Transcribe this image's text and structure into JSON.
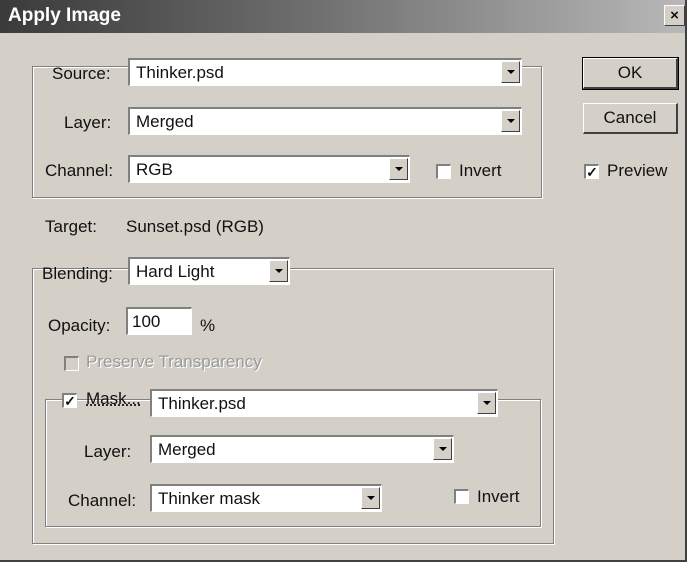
{
  "window": {
    "title": "Apply Image",
    "close_glyph": "×"
  },
  "source": {
    "source_label": "Source:",
    "source_value": "Thinker.psd",
    "layer_label": "Layer:",
    "layer_value": "Merged",
    "channel_label": "Channel:",
    "channel_value": "RGB",
    "invert_label": "Invert",
    "invert_checked": false
  },
  "target": {
    "label": "Target:",
    "value": "Sunset.psd (RGB)"
  },
  "blending": {
    "blending_label": "Blending:",
    "blending_value": "Hard Light",
    "opacity_label": "Opacity:",
    "opacity_value": "100",
    "opacity_unit": "%",
    "preserve_label": "Preserve Transparency",
    "preserve_enabled": false,
    "mask_label": "Mask...",
    "mask_checked": true,
    "mask_value": "Thinker.psd",
    "mask_layer_label": "Layer:",
    "mask_layer_value": "Merged",
    "mask_channel_label": "Channel:",
    "mask_channel_value": "Thinker mask",
    "mask_invert_label": "Invert",
    "mask_invert_checked": false
  },
  "buttons": {
    "ok": "OK",
    "cancel": "Cancel"
  },
  "preview": {
    "label": "Preview",
    "checked": true
  },
  "check_glyph": "✓"
}
